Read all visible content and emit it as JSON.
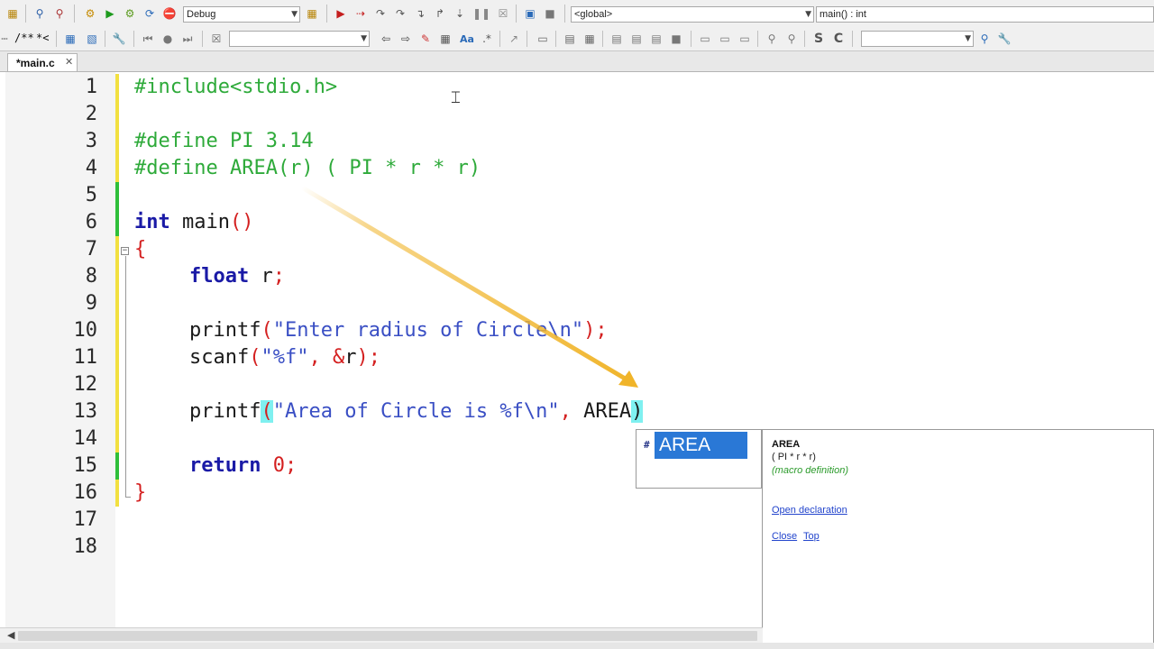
{
  "toolbar": {
    "build_config": "Debug",
    "scope": "<global>",
    "symbol": "main() : int",
    "comment_label": "/**",
    "uncomment_label": "*<",
    "search_value": "",
    "search_value2": "",
    "icons": [
      "open-icon",
      "search-icon",
      "replace-icon",
      "build-gear-icon",
      "run-icon",
      "build-run-icon",
      "rebuild-icon",
      "debug-run-icon",
      "step-icon",
      "pause-icon",
      "stop-icon"
    ]
  },
  "tabs": [
    {
      "label": "*main.c",
      "modified": true
    }
  ],
  "editor": {
    "line_numbers": [
      "1",
      "2",
      "3",
      "4",
      "5",
      "6",
      "7",
      "8",
      "9",
      "10",
      "11",
      "12",
      "13",
      "14",
      "15",
      "16",
      "17",
      "18"
    ],
    "lines": {
      "l1": "#include<stdio.h>",
      "l3": "#define PI 3.14",
      "l4": "#define AREA(r) ( PI * r * r)",
      "l6_kw": "int",
      "l6_fn": " main",
      "l6_paren": "()",
      "l7": "{",
      "l8_kw": "float",
      "l8_rest": " r",
      "l8_semi": ";",
      "l10_fn": "printf",
      "l10_open": "(",
      "l10_str": "\"Enter radius of Circle\\n\"",
      "l10_close": ");",
      "l11_fn": "scanf",
      "l11_open": "(",
      "l11_str": "\"%f\"",
      "l11_comma": ", &",
      "l11_r": "r",
      "l11_close": ");",
      "l13_fn": "printf",
      "l13_open": "(",
      "l13_str": "\"Area of Circle is %f\\n\"",
      "l13_comma": ",",
      "l13_rest": " AREA",
      "l13_close": ")",
      "l15_kw": "return",
      "l15_num": " 0",
      "l15_semi": ";",
      "l16": "}"
    }
  },
  "autocomplete": {
    "item_icon": "#",
    "item_label": "AREA",
    "doc_name": "AREA",
    "doc_definition": "( PI * r * r)",
    "doc_kind": "(macro definition)",
    "link_open": "Open declaration",
    "link_close": "Close",
    "link_top": "Top"
  },
  "colors": {
    "preprocessor": "#2eaa3a",
    "keyword": "#1a1aa6",
    "string": "#3a4fc4",
    "punctuation": "#d42020",
    "brace_match": "#7ff0f0",
    "selection": "#2a78d6",
    "arrow": "#f0b429"
  }
}
